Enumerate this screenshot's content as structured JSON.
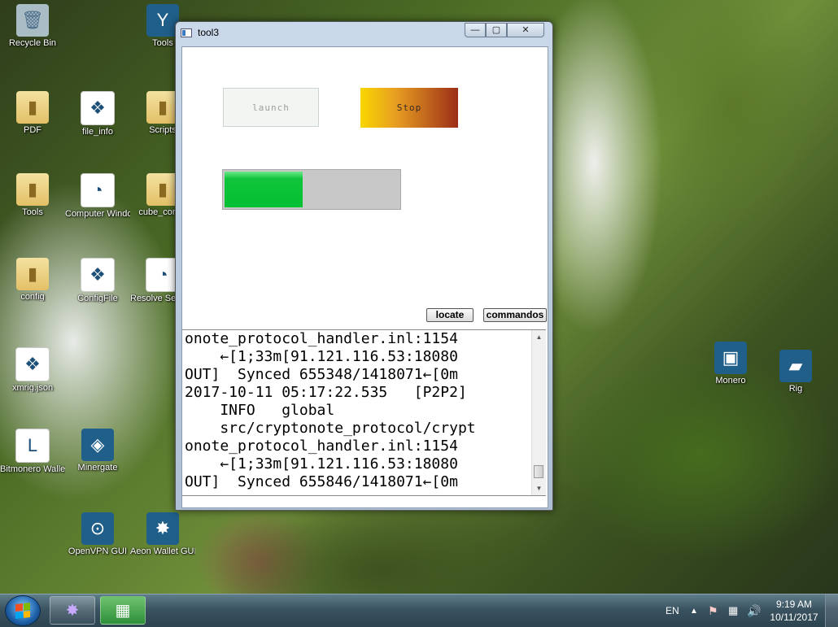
{
  "desktop": {
    "icons": [
      {
        "label": "Recycle Bin",
        "glyph": "🗑",
        "kind": "recycle"
      },
      {
        "label": "Tools",
        "glyph": "Y",
        "kind": "app"
      },
      {
        "label": "PDF",
        "glyph": "▮",
        "kind": "folder"
      },
      {
        "label": "file_info",
        "glyph": "❖",
        "kind": "file"
      },
      {
        "label": "Scripts",
        "glyph": "▮",
        "kind": "folder"
      },
      {
        "label": "Tools",
        "glyph": "▮",
        "kind": "folder"
      },
      {
        "label": "Computer Windows",
        "glyph": "◔",
        "kind": "file"
      },
      {
        "label": "cube_config",
        "glyph": "▮",
        "kind": "folder"
      },
      {
        "label": "config",
        "glyph": "▮",
        "kind": "folder"
      },
      {
        "label": "ConfigFile",
        "glyph": "❖",
        "kind": "file"
      },
      {
        "label": "Resolve Settings",
        "glyph": "◔",
        "kind": "file"
      },
      {
        "label": "xmrig.json",
        "glyph": "❖",
        "kind": "file"
      },
      {
        "label": "Bitmonero Wallet Generator",
        "glyph": "L",
        "kind": "file"
      },
      {
        "label": "Minergate",
        "glyph": "◈",
        "kind": "app"
      },
      {
        "label": "OpenVPN GUI",
        "glyph": "⊙",
        "kind": "app"
      },
      {
        "label": "Aeon Wallet GUI",
        "glyph": "✸",
        "kind": "app"
      },
      {
        "label": "Monero",
        "glyph": "▣",
        "kind": "app"
      },
      {
        "label": "Rig",
        "glyph": "▰",
        "kind": "app"
      }
    ]
  },
  "window": {
    "title": "tool3",
    "controls": {
      "minimize": "—",
      "maximize": "▢",
      "close": "✕"
    },
    "launch_label": "launch",
    "stop_label": "Stop",
    "progress": 0.45,
    "locate_label": "locate",
    "commandos_label": "commandos",
    "console": {
      "lines": [
        "onote_protocol_handler.inl:1154",
        "    ←[1;33m[91.121.116.53:18080",
        "OUT]  Synced 655348/1418071←[0m",
        "2017-10-11 05:17:22.535   [P2P2]",
        "    INFO   global",
        "    src/cryptonote_protocol/crypt",
        "onote_protocol_handler.inl:1154",
        "    ←[1;33m[91.121.116.53:18080",
        "OUT]  Synced 655846/1418071←[0m"
      ]
    }
  },
  "taskbar": {
    "language": "EN",
    "tray_arrow": "▲",
    "tray_flag": "⚑",
    "tray_network": "▦",
    "tray_volume": "🔊",
    "time": "9:19 AM",
    "date": "10/11/2017"
  }
}
